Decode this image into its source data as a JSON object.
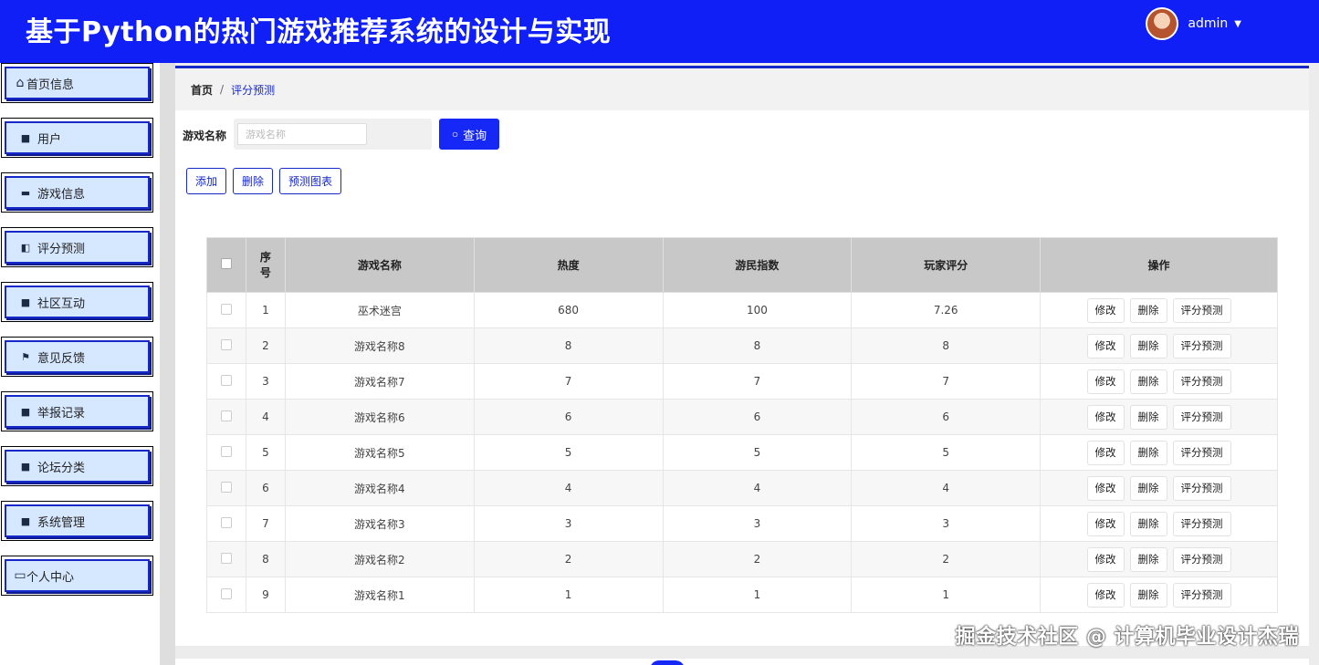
{
  "header": {
    "title": "基于Python的热门游戏推荐系统的设计与实现",
    "user": "admin"
  },
  "sidebar": {
    "items": [
      {
        "label": "首页信息",
        "icon": "home-icon"
      },
      {
        "label": "用户",
        "icon": "grid-icon"
      },
      {
        "label": "游戏信息",
        "icon": "briefcase-icon"
      },
      {
        "label": "评分预测",
        "icon": "wallet-icon"
      },
      {
        "label": "社区互动",
        "icon": "grid-icon"
      },
      {
        "label": "意见反馈",
        "icon": "flag-icon"
      },
      {
        "label": "举报记录",
        "icon": "grid-icon"
      },
      {
        "label": "论坛分类",
        "icon": "grid-icon"
      },
      {
        "label": "系统管理",
        "icon": "grid-icon"
      },
      {
        "label": "个人中心",
        "icon": "card-icon"
      }
    ]
  },
  "breadcrumb": {
    "home": "首页",
    "separator": "/",
    "current": "评分预测"
  },
  "search": {
    "label": "游戏名称",
    "placeholder": "游戏名称",
    "button": "查询"
  },
  "actions": {
    "add": "添加",
    "delete": "删除",
    "chart": "预测图表"
  },
  "table": {
    "headers": [
      "序号",
      "游戏名称",
      "热度",
      "游民指数",
      "玩家评分",
      "操作"
    ],
    "row_actions": {
      "edit": "修改",
      "delete": "删除",
      "predict": "评分预测"
    },
    "rows": [
      {
        "no": "1",
        "name": "巫术迷宫",
        "heat": "680",
        "index": "100",
        "score": "7.26"
      },
      {
        "no": "2",
        "name": "游戏名称8",
        "heat": "8",
        "index": "8",
        "score": "8"
      },
      {
        "no": "3",
        "name": "游戏名称7",
        "heat": "7",
        "index": "7",
        "score": "7"
      },
      {
        "no": "4",
        "name": "游戏名称6",
        "heat": "6",
        "index": "6",
        "score": "6"
      },
      {
        "no": "5",
        "name": "游戏名称5",
        "heat": "5",
        "index": "5",
        "score": "5"
      },
      {
        "no": "6",
        "name": "游戏名称4",
        "heat": "4",
        "index": "4",
        "score": "4"
      },
      {
        "no": "7",
        "name": "游戏名称3",
        "heat": "3",
        "index": "3",
        "score": "3"
      },
      {
        "no": "8",
        "name": "游戏名称2",
        "heat": "2",
        "index": "2",
        "score": "2"
      },
      {
        "no": "9",
        "name": "游戏名称1",
        "heat": "1",
        "index": "1",
        "score": "1"
      }
    ]
  },
  "watermark": "掘金技术社区 @ 计算机毕业设计杰瑞",
  "colors": {
    "primary": "#1628f5",
    "header": "#0f1ff5",
    "menu_bg": "#d6e8ff"
  }
}
